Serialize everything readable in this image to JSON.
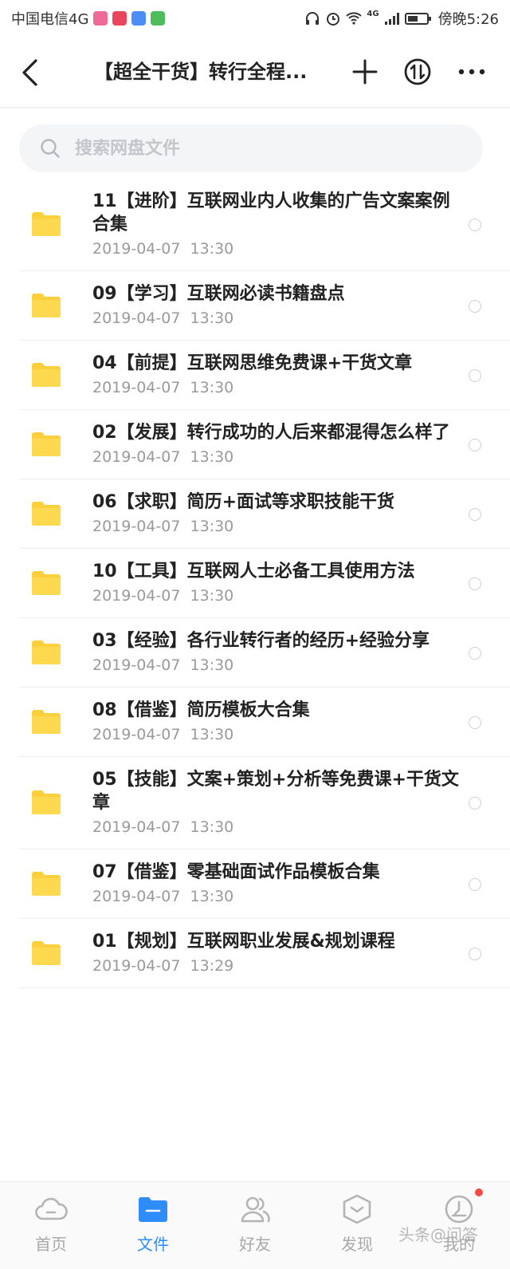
{
  "status_bar": {
    "carrier": "中国电信4G",
    "network": "4G",
    "time": "傍晚5:26"
  },
  "header": {
    "title": "【超全干货】转行全程..."
  },
  "search": {
    "placeholder": "搜索网盘文件"
  },
  "files": [
    {
      "name": "11【进阶】互联网业内人收集的广告文案案例合集",
      "date": "2019-04-07  13:30"
    },
    {
      "name": "09【学习】互联网必读书籍盘点",
      "date": "2019-04-07  13:30"
    },
    {
      "name": "04【前提】互联网思维免费课+干货文章",
      "date": "2019-04-07  13:30"
    },
    {
      "name": "02【发展】转行成功的人后来都混得怎么样了",
      "date": "2019-04-07  13:30"
    },
    {
      "name": "06【求职】简历+面试等求职技能干货",
      "date": "2019-04-07  13:30"
    },
    {
      "name": "10【工具】互联网人士必备工具使用方法",
      "date": "2019-04-07  13:30"
    },
    {
      "name": "03【经验】各行业转行者的经历+经验分享",
      "date": "2019-04-07  13:30"
    },
    {
      "name": "08【借鉴】简历模板大合集",
      "date": "2019-04-07  13:30"
    },
    {
      "name": "05【技能】文案+策划+分析等免费课+干货文章",
      "date": "2019-04-07  13:30"
    },
    {
      "name": "07【借鉴】零基础面试作品模板合集",
      "date": "2019-04-07  13:30"
    },
    {
      "name": "01【规划】互联网职业发展&规划课程",
      "date": "2019-04-07  13:29"
    }
  ],
  "tabs": [
    {
      "label": "首页",
      "icon": "cloud-icon"
    },
    {
      "label": "文件",
      "icon": "folder-icon"
    },
    {
      "label": "好友",
      "icon": "friends-icon"
    },
    {
      "label": "发现",
      "icon": "discover-icon"
    },
    {
      "label": "我的",
      "icon": "profile-icon"
    }
  ],
  "active_tab": "文件",
  "watermark": "头条@问答",
  "colors": {
    "accent": "#2e8dfb",
    "folder": "#fcd03d",
    "badge": "#f24b44"
  }
}
